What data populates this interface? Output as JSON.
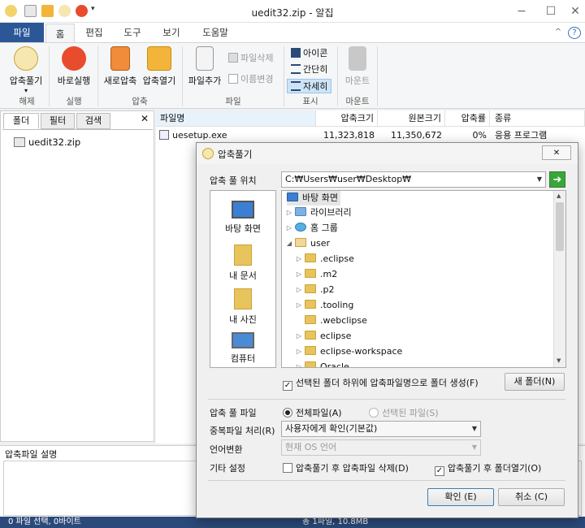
{
  "window": {
    "title": "uedit32.zip - 알집",
    "minimize": "−",
    "maximize": "☐",
    "close": "✕"
  },
  "ribbon_tabs": [
    "파일",
    "홈",
    "편집",
    "도구",
    "보기",
    "도움말"
  ],
  "ribbon": {
    "extract": "압축풀기",
    "run": "바로실행",
    "new_zip": "새로압축",
    "open_zip": "압축열기",
    "add_file": "파일추가",
    "delete_file": "파일삭제",
    "rename": "이름변경",
    "view_icon": "아이콘",
    "view_simple": "간단히",
    "view_detail": "자세히",
    "mount": "마운트",
    "groups": {
      "extract": "해제",
      "run": "실행",
      "compress": "압축",
      "file": "파일",
      "view": "표시",
      "mount": "마운트"
    },
    "help_icon": "?",
    "collapse_icon": "^"
  },
  "left_panel": {
    "tabs": [
      "폴더",
      "필터",
      "검색"
    ],
    "close": "✕",
    "tree_root": "uedit32.zip"
  },
  "file_list": {
    "columns": [
      "파일명",
      "압축크기",
      "원본크기",
      "압축률",
      "종류"
    ],
    "rows": [
      {
        "name": "uesetup.exe",
        "packed": "11,323,818",
        "original": "11,350,672",
        "ratio": "0%",
        "type": "응용 프로그램"
      }
    ]
  },
  "description": {
    "label": "압축파일 설명"
  },
  "status": {
    "selected": "0 파일 선택, 0바이트",
    "total": "총 1파일, 10.8MB"
  },
  "dialog": {
    "title": "압축풀기",
    "close": "✕",
    "path_label": "압축 풀 위치",
    "path_value": "C:₩Users₩user₩Desktop₩",
    "places": [
      "바탕 화면",
      "내 문서",
      "내 사진",
      "컴퓨터"
    ],
    "tree": [
      "바탕 화면",
      "라이브러리",
      "홈 그룹",
      "user",
      ".eclipse",
      ".m2",
      ".p2",
      ".tooling",
      ".webclipse",
      "eclipse",
      "eclipse-workspace",
      "Oracle"
    ],
    "create_subfolder": "선택된 폴더 하위에 압축파일명으로 폴더 생성(F)",
    "new_folder": "새 폴더(N)",
    "files_label": "압축 풀 파일",
    "all_files": "전체파일(A)",
    "selected_files": "선택된 파일(S)",
    "dup_label": "중복파일 처리(R)",
    "dup_value": "사용자에게 확인(기본값)",
    "lang_label": "언어변환",
    "lang_value": "현재 OS 언어",
    "etc_label": "기타 설정",
    "delete_after": "압축풀기 후 압축파일 삭제(D)",
    "open_after": "압축풀기 후 폴더열기(O)",
    "ok": "확인 (E)",
    "cancel": "취소 (C)"
  },
  "colors": {
    "ribbon_file_tab": "#2b5797",
    "status_bar": "#2b4a7a",
    "accent_go": "#3aa63a",
    "selected_view": "#cde4f7"
  }
}
